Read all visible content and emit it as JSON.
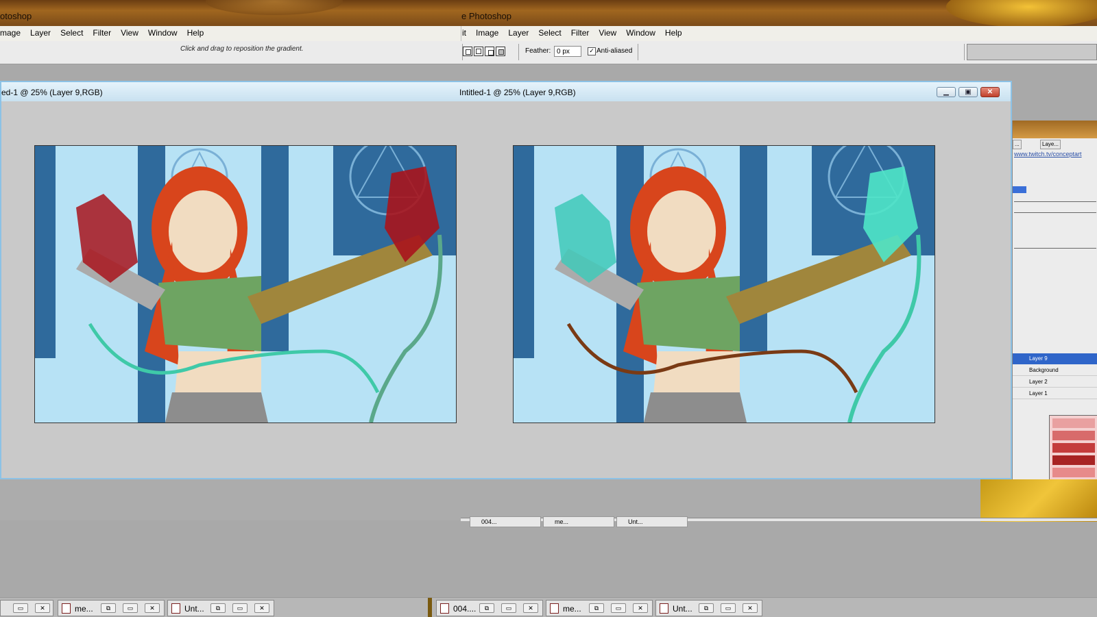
{
  "app": {
    "left_title": "otoshop",
    "right_title": "e Photoshop"
  },
  "menubar": {
    "left_items": [
      "mage",
      "Layer",
      "Select",
      "Filter",
      "View",
      "Window",
      "Help"
    ],
    "right_items": [
      "it",
      "Image",
      "Layer",
      "Select",
      "Filter",
      "View",
      "Window",
      "Help"
    ]
  },
  "options": {
    "hint": "Click and drag to reposition the gradient.",
    "feather_label": "Feather:",
    "feather_value": "0 px",
    "antialias_label": "Anti-aliased",
    "antialias_checked": true
  },
  "document": {
    "left_title": "ed-1 @ 25% (Layer 9,RGB)",
    "right_title": "Intitled-1 @ 25% (Layer 9,RGB)",
    "buttons": [
      "minimize",
      "restore",
      "close"
    ]
  },
  "canvas": {
    "left_glow_color": "#a8141c",
    "right_glow_color": "#3fe0c8"
  },
  "side_panel": {
    "url": "www.twitch.tv/conceptart",
    "tabs": [
      "...",
      "Laye..."
    ],
    "layers": [
      "Layer 9",
      "Background",
      "Layer 2",
      "Layer 1"
    ]
  },
  "minimized_upper": [
    {
      "name": "004..."
    },
    {
      "name": "me..."
    },
    {
      "name": "Unt..."
    }
  ],
  "taskbar_left": [
    {
      "name": "me..."
    },
    {
      "name": "Unt..."
    }
  ],
  "taskbar_right": [
    {
      "name": "004...."
    },
    {
      "name": "me..."
    },
    {
      "name": "Unt..."
    }
  ],
  "colors": {
    "title_bar_accent": "#8cc2e6",
    "sky_blue": "#b7e2f5",
    "deep_blue": "#2f6a9c"
  }
}
